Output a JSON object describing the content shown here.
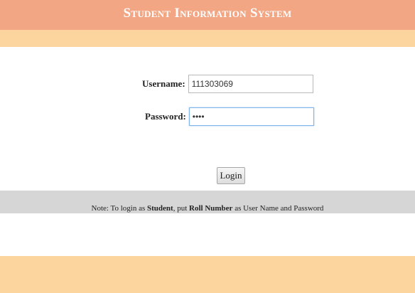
{
  "header": {
    "title": "Student Information System"
  },
  "login_form": {
    "username_label": "Username:",
    "username_value": "111303069",
    "password_label": "Password:",
    "password_value": "1111",
    "login_button_label": "Login"
  },
  "note": {
    "prefix": "Note: To login as ",
    "student": "Student",
    "middle": ", put ",
    "roll_number": "Roll Number",
    "suffix": " as User Name and Password"
  },
  "colors": {
    "header_bar": "#f2a684",
    "header_strip": "#fbd59d",
    "note_panel": "#d6d6d6",
    "footer_bar": "#fbd59d"
  }
}
